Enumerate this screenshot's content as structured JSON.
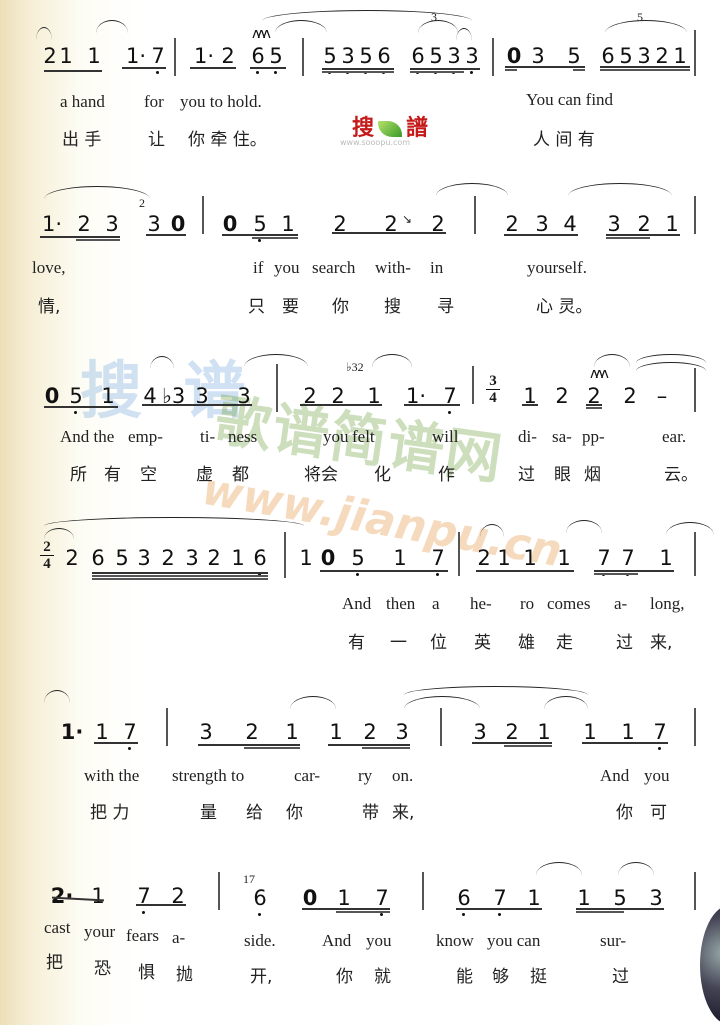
{
  "watermarks": {
    "logo_left": "搜",
    "logo_right": "譜",
    "logo_url": "www.sooopu.com",
    "big_blue": "搜 谱",
    "big_green": "歌谱简谱网",
    "big_url": "www.jianpu.cn"
  },
  "systems": [
    {
      "measures": [
        {
          "notes": [
            "2",
            "1",
            "1",
            "1·",
            "7"
          ]
        },
        {
          "notes": [
            "1·",
            "2",
            "6",
            "5"
          ]
        },
        {
          "notes": [
            "5",
            "3",
            "5",
            "6",
            "6",
            "5",
            "3",
            "3"
          ],
          "tuplet": "3"
        },
        {
          "notes": [
            "0",
            "3",
            "5",
            "6",
            "5",
            "3",
            "2",
            "1"
          ],
          "tuplet": "5"
        }
      ],
      "lyrics_en": [
        "a hand",
        "for",
        "you to hold.",
        "You can find"
      ],
      "lyrics_zh": [
        "出 手",
        "让",
        "你 牵 住。",
        "人 间 有"
      ]
    },
    {
      "measures": [
        {
          "notes": [
            "1·",
            "2",
            "3",
            "3",
            "0"
          ],
          "grace": "2"
        },
        {
          "notes": [
            "0",
            "5",
            "1",
            "2",
            "2",
            "2"
          ]
        },
        {
          "notes": [
            "2",
            "3",
            "4",
            "3",
            "2",
            "1"
          ]
        }
      ],
      "lyrics_en": [
        "love,",
        "if",
        "you",
        "search",
        "with-",
        "in",
        "yourself."
      ],
      "lyrics_zh": [
        "情,",
        "只",
        "要",
        "你",
        "搜",
        "寻",
        "心 灵。"
      ]
    },
    {
      "measures": [
        {
          "notes": [
            "0",
            "5",
            "1",
            "4",
            "♭3",
            "3",
            "3"
          ]
        },
        {
          "notes": [
            "2",
            "2",
            "1",
            "1·",
            "7"
          ],
          "grace": "♭32"
        },
        {
          "time_signature": {
            "top": "3",
            "bottom": "4"
          },
          "notes": [
            "1",
            "2",
            "2",
            "2",
            "–"
          ]
        }
      ],
      "lyrics_en": [
        "And the",
        "emp-",
        "ti-",
        "ness",
        "you",
        "felt",
        "will",
        "di-",
        "sa-",
        "pp-",
        "ear."
      ],
      "lyrics_zh": [
        "所",
        "有",
        "空",
        "虚",
        "都",
        "将会",
        "化",
        "作",
        "过",
        "眼",
        "烟",
        "云。"
      ]
    },
    {
      "measures": [
        {
          "time_signature": {
            "top": "2",
            "bottom": "4"
          },
          "notes": [
            "2",
            "6",
            "5",
            "3",
            "2",
            "3",
            "2",
            "1",
            "6"
          ]
        },
        {
          "notes": [
            "1",
            "0",
            "5",
            "1",
            "7"
          ]
        },
        {
          "notes": [
            "2",
            "1",
            "1",
            "1",
            "7",
            "7",
            "1"
          ]
        }
      ],
      "lyrics_en": [
        "And",
        "then",
        "a",
        "he-",
        "ro",
        "comes",
        "a-",
        "long,"
      ],
      "lyrics_zh": [
        "有",
        "一",
        "位",
        "英",
        "雄",
        "走",
        "过",
        "来,"
      ]
    },
    {
      "measures": [
        {
          "notes": [
            "1·",
            "1",
            "7"
          ]
        },
        {
          "notes": [
            "3",
            "2",
            "1",
            "1",
            "2",
            "3"
          ]
        },
        {
          "notes": [
            "3",
            "2",
            "1",
            "1",
            "1",
            "7"
          ]
        }
      ],
      "lyrics_en": [
        "with the",
        "strength to",
        "car-",
        "ry",
        "on.",
        "And",
        "you"
      ],
      "lyrics_zh": [
        "把 力",
        "量",
        "给",
        "你",
        "带",
        "来,",
        "你",
        "可"
      ]
    },
    {
      "measures": [
        {
          "notes": [
            "2·",
            "1",
            "7",
            "2"
          ]
        },
        {
          "notes": [
            "6",
            "0",
            "1",
            "7"
          ],
          "grace": "17"
        },
        {
          "notes": [
            "6",
            "7",
            "1",
            "1",
            "5",
            "3"
          ]
        }
      ],
      "lyrics_en": [
        "cast",
        "your",
        "fears",
        "a-",
        "side.",
        "And",
        "you",
        "know",
        "you can",
        "sur-"
      ],
      "lyrics_zh": [
        "把",
        "恐",
        "惧",
        "抛",
        "开,",
        "你",
        "就",
        "能",
        "够",
        "挺",
        "过"
      ]
    }
  ]
}
